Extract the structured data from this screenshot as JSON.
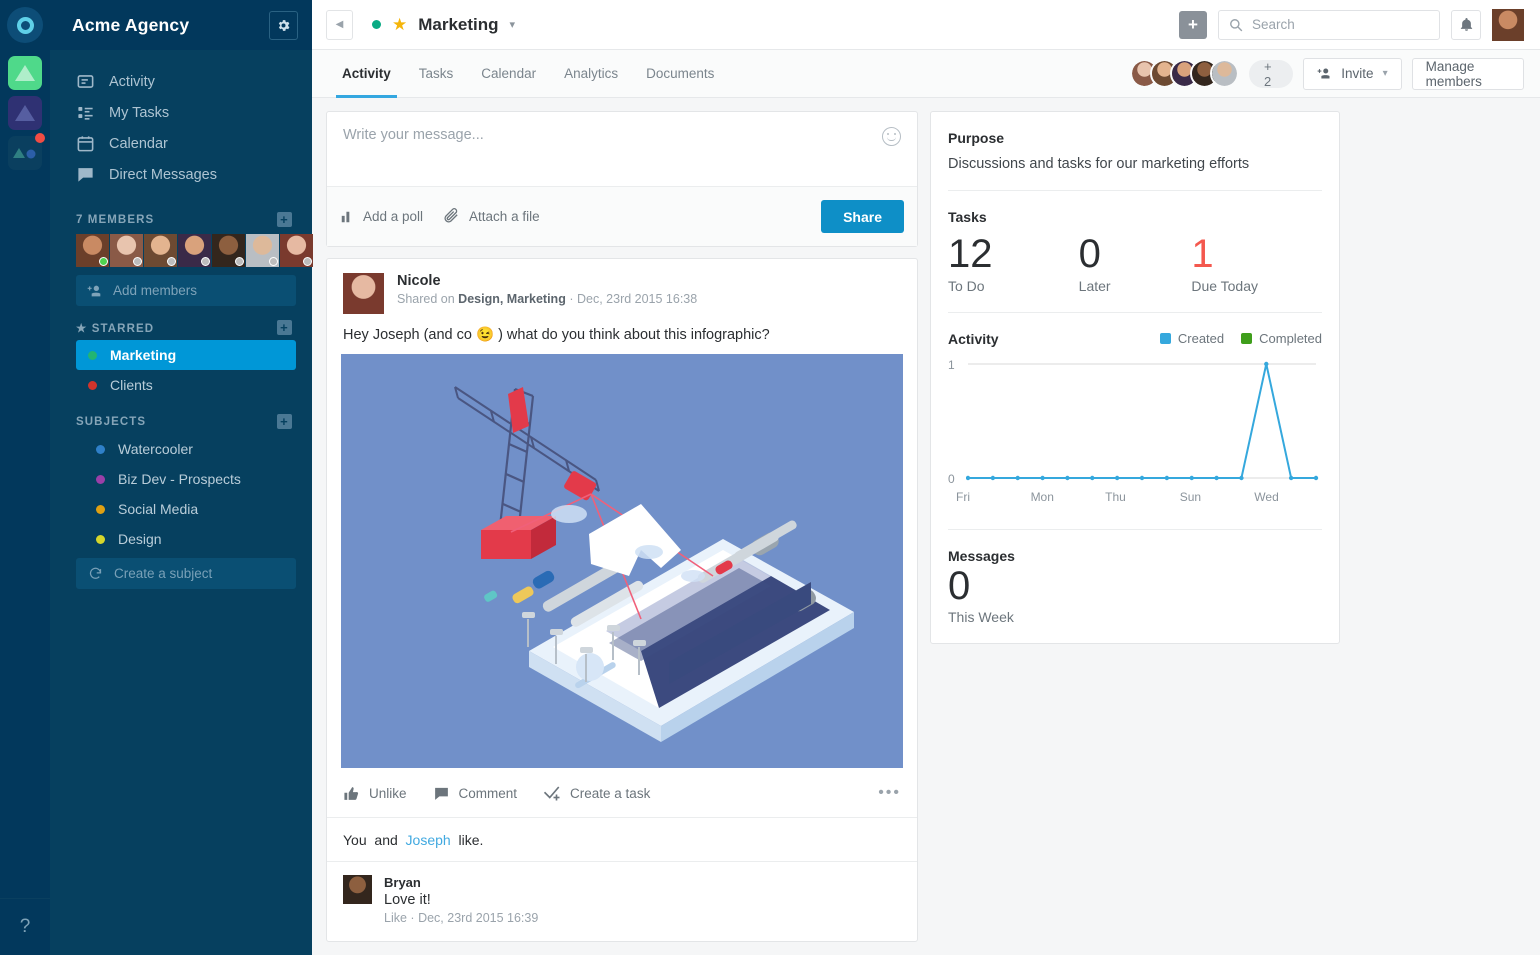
{
  "rail": {
    "logo_name": "acme-logo",
    "apps": [
      {
        "name": "workspace-green",
        "color": "#4fd98a"
      },
      {
        "name": "workspace-purple",
        "color": "#2f3173"
      },
      {
        "name": "workspace-dark",
        "color": "#0a3f5f",
        "badge": true
      }
    ],
    "help_label": "?"
  },
  "sidebar": {
    "title": "Acme Agency",
    "gear_icon": "gear-icon",
    "nav": [
      {
        "label": "Activity",
        "icon": "activity-icon"
      },
      {
        "label": "My Tasks",
        "icon": "tasks-icon"
      },
      {
        "label": "Calendar",
        "icon": "calendar-icon"
      },
      {
        "label": "Direct Messages",
        "icon": "chat-icon"
      }
    ],
    "members_header": "7 MEMBERS",
    "members_add_icon": "plus-icon",
    "member_count": 7,
    "add_members_label": "Add members",
    "starred_header": "STARRED",
    "starred": [
      {
        "label": "Marketing",
        "color": "#22b573",
        "active": true
      },
      {
        "label": "Clients",
        "color": "#d0342c",
        "active": false
      }
    ],
    "subjects_header": "SUBJECTS",
    "subjects": [
      {
        "label": "Watercooler",
        "color": "#2f80c9"
      },
      {
        "label": "Biz Dev - Prospects",
        "color": "#9b3fa8"
      },
      {
        "label": "Social Media",
        "color": "#e0a012"
      },
      {
        "label": "Design",
        "color": "#d6d62b"
      }
    ],
    "create_subject_label": "Create a subject"
  },
  "topbar": {
    "back_icon": "back-arrow-icon",
    "status_dot_color": "#0aab84",
    "star_icon": "star-icon",
    "channel_title": "Marketing",
    "caret_icon": "chevron-down-icon",
    "add_icon": "plus-icon",
    "search_placeholder": "Search",
    "search_value": "",
    "search_icon": "search-icon",
    "bell_icon": "bell-icon",
    "avatar_name": "user-avatar"
  },
  "tabs": [
    {
      "label": "Activity",
      "active": true
    },
    {
      "label": "Tasks",
      "active": false
    },
    {
      "label": "Calendar",
      "active": false
    },
    {
      "label": "Analytics",
      "active": false
    },
    {
      "label": "Documents",
      "active": false
    }
  ],
  "members_bar": {
    "facepile_count": 5,
    "overflow_label": "+ 2",
    "invite_label": "Invite",
    "invite_icon": "add-person-icon",
    "invite_caret": "chevron-down-icon",
    "manage_label": "Manage members"
  },
  "composer": {
    "placeholder": "Write your message...",
    "value": "",
    "emoji_icon": "smiley-icon",
    "poll_label": "Add a poll",
    "poll_icon": "bar-chart-icon",
    "attach_label": "Attach a file",
    "attach_icon": "paperclip-icon",
    "share_label": "Share"
  },
  "post": {
    "author": "Nicole",
    "meta_prefix": "Shared on",
    "meta_channels": "Design, Marketing",
    "meta_sep": "·",
    "meta_date": "Dec, 23rd 2015 16:38",
    "text": "Hey Joseph (and co 😉 ) what do you think about this infographic?",
    "image_name": "isometric-smartphone-crane-infographic",
    "image_bg": "#7190c9",
    "actions": [
      {
        "label": "Unlike",
        "icon": "thumbs-up-icon"
      },
      {
        "label": "Comment",
        "icon": "comment-icon"
      },
      {
        "label": "Create a task",
        "icon": "check-task-icon"
      }
    ],
    "more_icon": "more-dots-icon",
    "likes_prefix": "You",
    "likes_and": "and",
    "likes_user": "Joseph",
    "likes_suffix": "like.",
    "comment": {
      "author": "Bryan",
      "body": "Love it!",
      "like_label": "Like",
      "sep": "·",
      "date": "Dec, 23rd 2015 16:39"
    }
  },
  "right_panel": {
    "purpose_header": "Purpose",
    "purpose_text": "Discussions and tasks for our marketing efforts",
    "tasks_header": "Tasks",
    "tasks": [
      {
        "value": "12",
        "label": "To Do",
        "color": "#2b2e31"
      },
      {
        "value": "0",
        "label": "Later",
        "color": "#2b2e31"
      },
      {
        "value": "1",
        "label": "Due Today",
        "color": "#f4584e"
      }
    ],
    "activity_header": "Activity",
    "legend": [
      {
        "label": "Created",
        "color": "#35a8dd"
      },
      {
        "label": "Completed",
        "color": "#3f9e1b"
      }
    ],
    "messages_header": "Messages",
    "messages_value": "0",
    "messages_label": "This Week"
  },
  "chart_data": {
    "type": "line",
    "title": "Activity",
    "xlabel": "",
    "ylabel": "",
    "ylim": [
      0,
      1
    ],
    "yticks": [
      0,
      1
    ],
    "ytick_labels": [
      "0",
      "1"
    ],
    "grid": true,
    "legend_position": "top-right",
    "x": [
      0,
      1,
      2,
      3,
      4,
      5,
      6,
      7,
      8,
      9,
      10,
      11,
      12,
      13,
      14
    ],
    "tick_labels": [
      "Fri",
      "",
      "",
      "Mon",
      "",
      "",
      "Thu",
      "",
      "",
      "Sun",
      "",
      "",
      "Wed",
      "",
      ""
    ],
    "series": [
      {
        "name": "Created",
        "color": "#35a8dd",
        "values": [
          0,
          0,
          0,
          0,
          0,
          0,
          0,
          0,
          0,
          0,
          0,
          0,
          1,
          0,
          0
        ]
      },
      {
        "name": "Completed",
        "color": "#3f9e1b",
        "values": [
          0,
          0,
          0,
          0,
          0,
          0,
          0,
          0,
          0,
          0,
          0,
          0,
          0,
          0,
          0
        ]
      }
    ]
  }
}
